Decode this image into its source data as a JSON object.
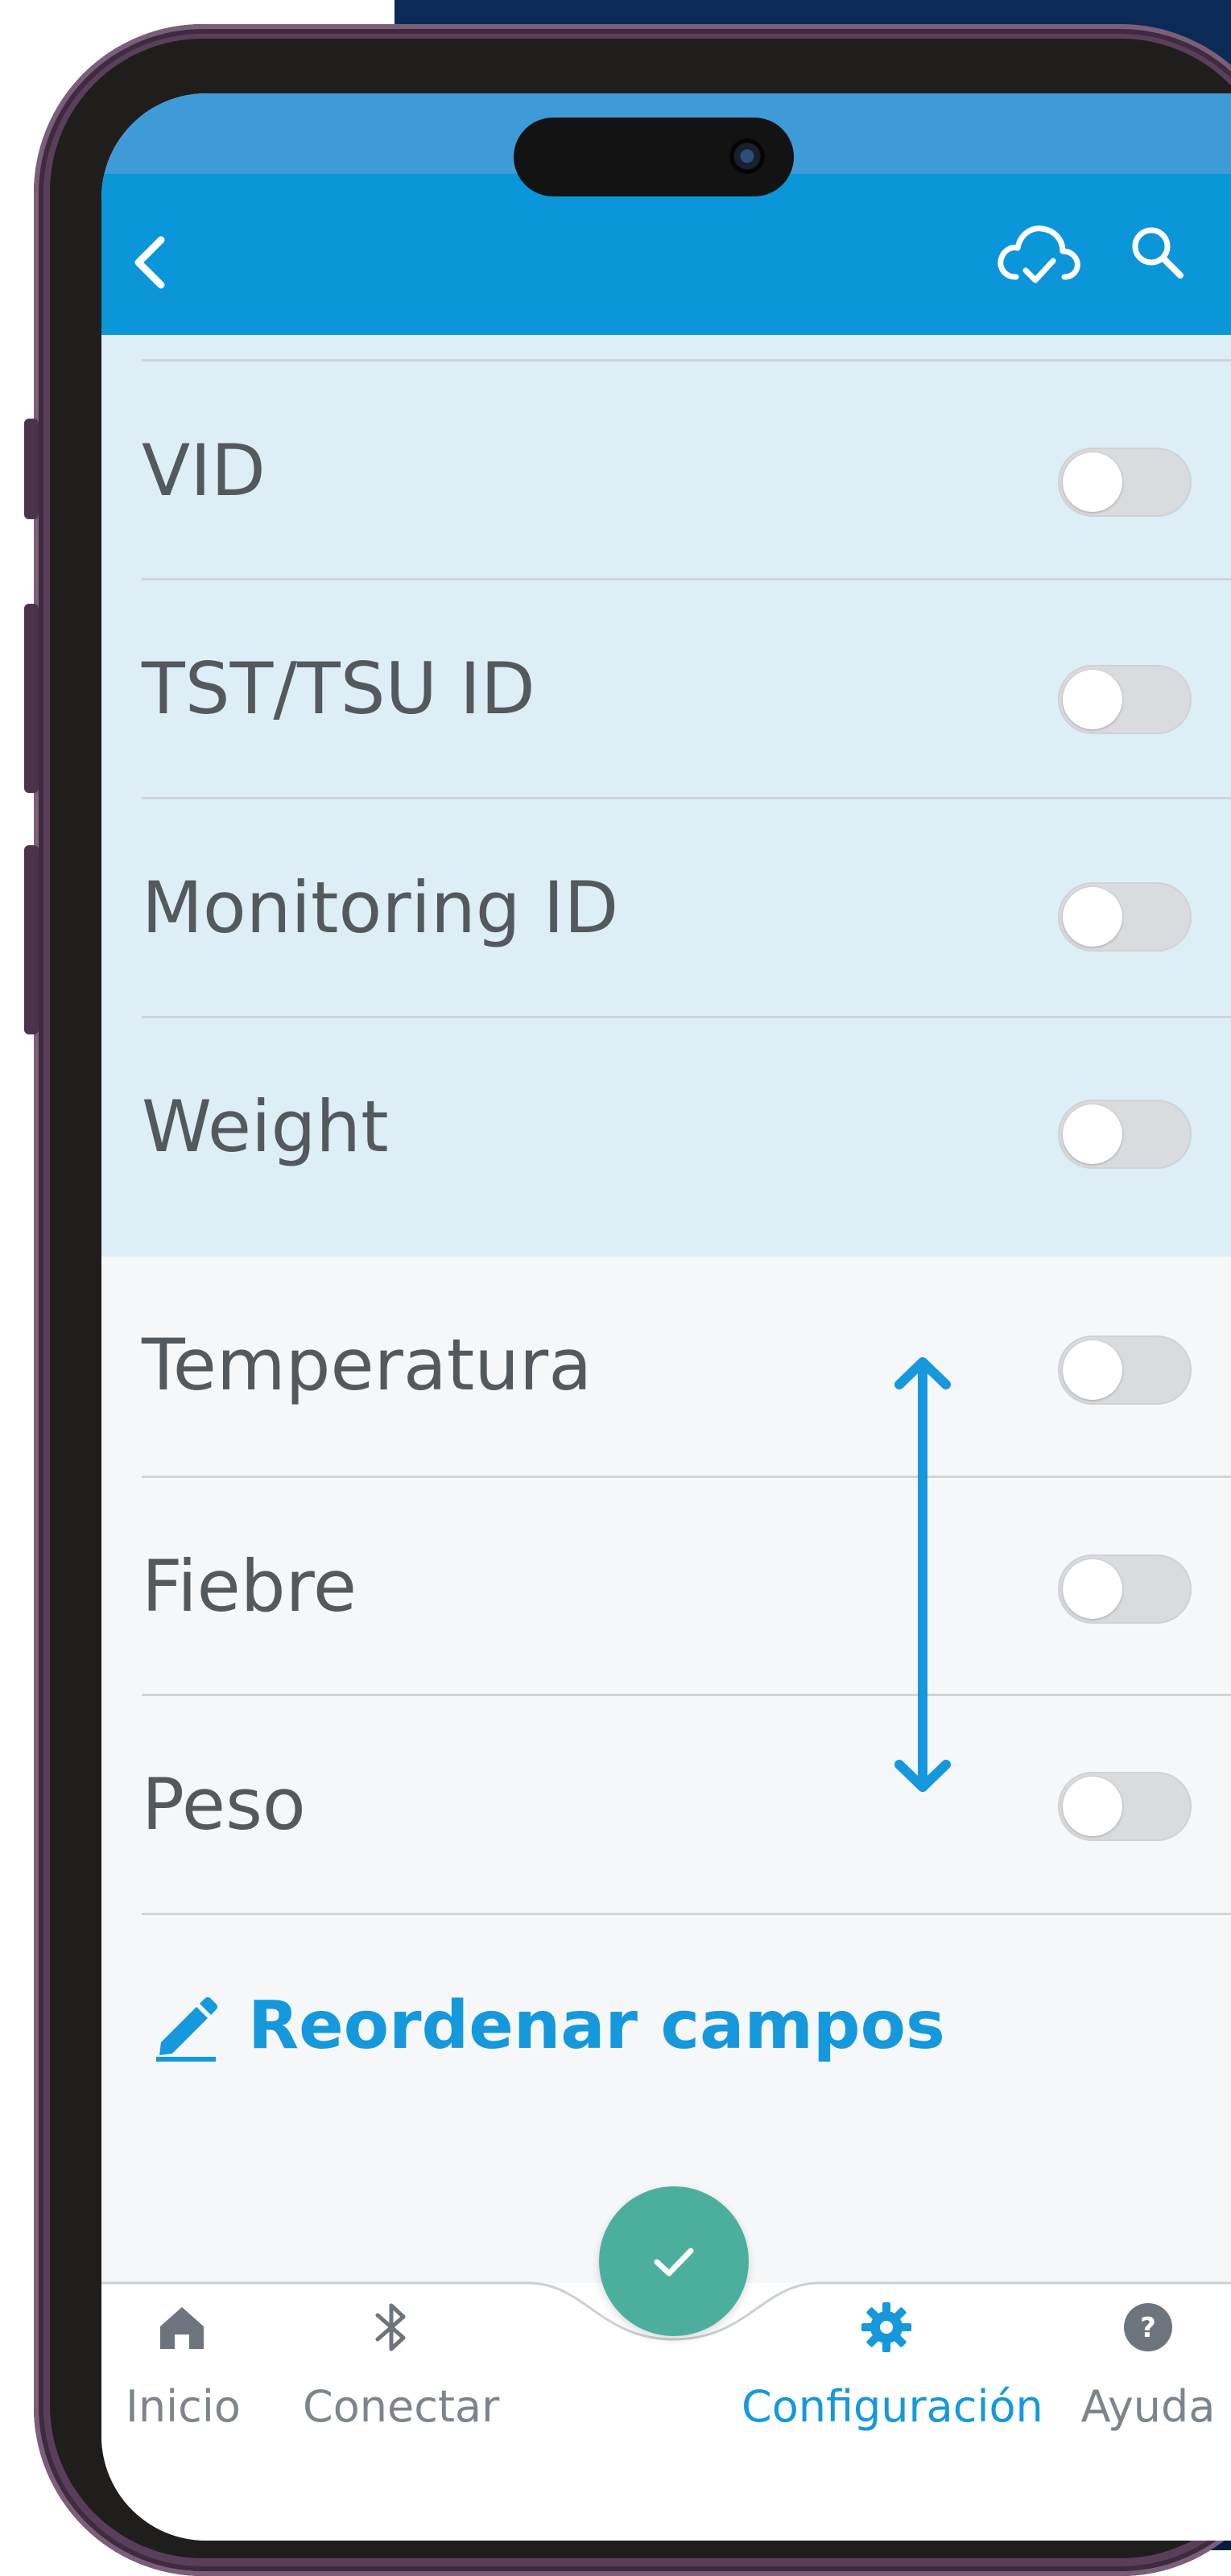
{
  "top_bar": {
    "back_icon": "chevron-left-icon",
    "sync_icon": "cloud-check-icon",
    "search_icon": "search-icon",
    "color": "#0a96d9"
  },
  "fields": [
    {
      "label": "VID",
      "enabled": false
    },
    {
      "label": "TST/TSU ID",
      "enabled": false
    },
    {
      "label": "Monitoring ID",
      "enabled": false
    },
    {
      "label": "Weight",
      "enabled": false
    },
    {
      "label": "Temperatura",
      "enabled": false
    },
    {
      "label": "Fiebre",
      "enabled": false
    },
    {
      "label": "Peso",
      "enabled": false
    }
  ],
  "reorder": {
    "label": "Reordenar campos",
    "icon": "pencil-icon"
  },
  "fab": {
    "icon": "check-icon",
    "color": "#4caf9e"
  },
  "bottom_nav": {
    "items": [
      {
        "label": "Inicio",
        "icon": "home-icon",
        "active": false
      },
      {
        "label": "Conectar",
        "icon": "bluetooth-icon",
        "active": false
      },
      {
        "label": "Configuración",
        "icon": "gear-icon",
        "active": true
      },
      {
        "label": "Ayuda",
        "icon": "help-icon",
        "active": false
      }
    ]
  },
  "colors": {
    "accent": "#1598dc",
    "highlight_section": "#ddeef6",
    "text": "#54595e"
  }
}
